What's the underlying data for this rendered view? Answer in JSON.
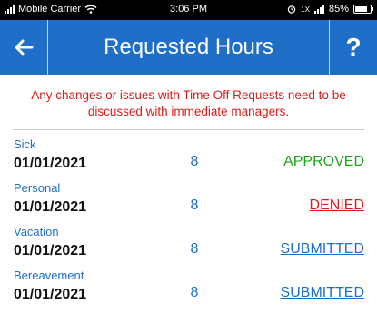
{
  "status_bar": {
    "carrier": "Mobile Carrier",
    "time": "3:06 PM",
    "battery": "85%",
    "battery_level": 0.85,
    "network_label": "1X"
  },
  "header": {
    "title": "Requested Hours",
    "back_icon": "left-arrow",
    "help_label": "?"
  },
  "notice": "Any changes or issues with Time Off Requests need to be discussed with immediate managers.",
  "colors": {
    "primary": "#1f6ec7",
    "approved": "#1fa11f",
    "denied": "#e01919",
    "submitted": "#1f6ec7",
    "notice": "#e01919"
  },
  "requests": [
    {
      "type": "Sick",
      "date": "01/01/2021",
      "hours": "8",
      "status": "APPROVED"
    },
    {
      "type": "Personal",
      "date": "01/01/2021",
      "hours": "8",
      "status": "DENIED"
    },
    {
      "type": "Vacation",
      "date": "01/01/2021",
      "hours": "8",
      "status": "SUBMITTED"
    },
    {
      "type": "Bereavement",
      "date": "01/01/2021",
      "hours": "8",
      "status": "SUBMITTED"
    }
  ]
}
